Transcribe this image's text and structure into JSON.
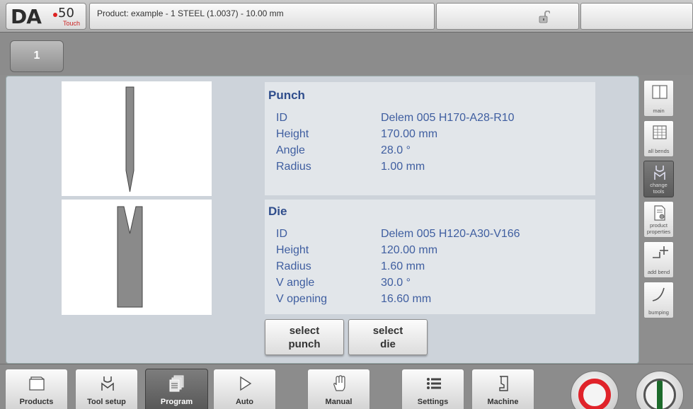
{
  "header": {
    "logo_text": "DA",
    "logo_number": "50",
    "logo_sub": "Touch",
    "product_title": "Product: example - 1 STEEL (1.0037) - 10.00 mm"
  },
  "tabs": [
    {
      "label": "1"
    }
  ],
  "punch": {
    "title": "Punch",
    "rows": [
      {
        "label": "ID",
        "value": "Delem 005 H170-A28-R10"
      },
      {
        "label": "Height",
        "value": "170.00 mm"
      },
      {
        "label": "Angle",
        "value": "28.0 °"
      },
      {
        "label": "Radius",
        "value": "1.00 mm"
      }
    ]
  },
  "die": {
    "title": "Die",
    "rows": [
      {
        "label": "ID",
        "value": "Delem 005 H120-A30-V166"
      },
      {
        "label": "Height",
        "value": "120.00 mm"
      },
      {
        "label": "Radius",
        "value": "1.60 mm"
      },
      {
        "label": "V angle",
        "value": "30.0 °"
      },
      {
        "label": "V opening",
        "value": "16.60 mm"
      }
    ]
  },
  "actions": {
    "select_punch_line1": "select",
    "select_punch_line2": "punch",
    "select_die_line1": "select",
    "select_die_line2": "die"
  },
  "side_menu": [
    {
      "label": "main",
      "icon": "main-view-icon"
    },
    {
      "label": "all bends",
      "icon": "table-icon"
    },
    {
      "label": "change tools",
      "icon": "change-tools-icon",
      "active": true
    },
    {
      "label": "product properties",
      "icon": "document-properties-icon"
    },
    {
      "label": "add bend",
      "icon": "add-bend-icon"
    },
    {
      "label": "bumping",
      "icon": "bumping-curve-icon"
    }
  ],
  "nav": [
    {
      "label": "Products",
      "icon": "folder-icon"
    },
    {
      "label": "Tool setup",
      "icon": "tool-setup-icon"
    },
    {
      "label": "Program",
      "icon": "program-pages-icon",
      "active": true
    },
    {
      "label": "Auto",
      "icon": "play-icon"
    },
    {
      "label": "Manual",
      "icon": "hand-icon"
    },
    {
      "label": "Settings",
      "icon": "list-settings-icon"
    },
    {
      "label": "Machine",
      "icon": "machine-icon"
    }
  ],
  "colors": {
    "accent_title": "#2f4d8c",
    "text_value": "#3f5ea0",
    "stop": "#e0232a",
    "start": "#1d6b2c"
  }
}
